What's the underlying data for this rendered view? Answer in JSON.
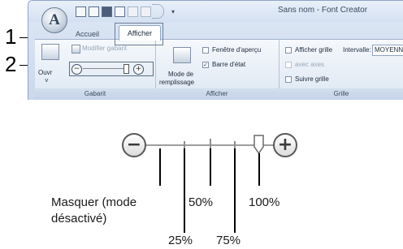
{
  "callouts": {
    "one": "1",
    "two": "2"
  },
  "window": {
    "title": "Sans nom - Font Creator",
    "app_button_letter": "A",
    "qat_menu_glyph": "▾"
  },
  "tabs": {
    "inactive": "Accueil",
    "active": "Afficher"
  },
  "ribbon": {
    "gabarit": {
      "label": "Gabarit",
      "open_label": "Ouvr",
      "open_arrow": "˅",
      "modify_label": "Modifier gabarit",
      "zoom_minus": "−",
      "zoom_plus": "+"
    },
    "afficher": {
      "label": "Afficher",
      "fill_mode_line1": "Mode de",
      "fill_mode_line2": "remplissage",
      "preview_window": "Fenêtre d'aperçu",
      "status_bar": "Barre d'état",
      "preview_checked": false,
      "status_checked": true
    },
    "grille": {
      "label": "Grille",
      "show_grid": "Afficher grille",
      "interval_label": "Intervalle:",
      "interval_value": "MOYENNE",
      "with_axes": "avec axes",
      "follow_grid": "Suivre grille"
    }
  },
  "zoom_slider": {
    "minus_symbol": "−",
    "plus_symbol": "+",
    "labels": {
      "hide_line1": "Masquer (mode",
      "hide_line2": "désactivé)",
      "p25": "25%",
      "p50": "50%",
      "p75": "75%",
      "p100": "100%"
    }
  },
  "colors": {
    "ribbon_blue": "#c9d8ec",
    "accent": "#1c3d6e"
  }
}
